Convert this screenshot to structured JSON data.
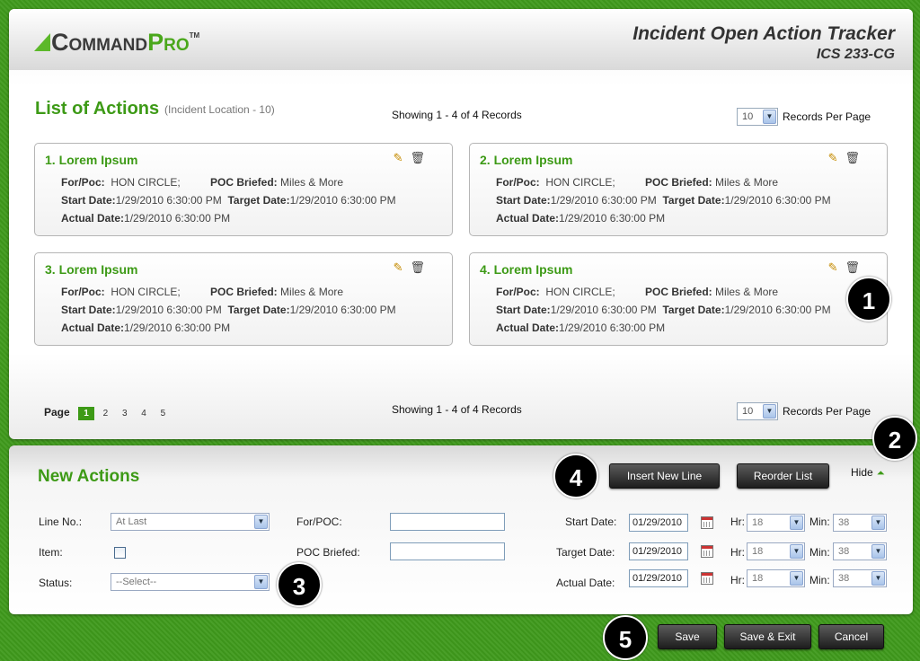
{
  "header": {
    "logo_command": "Command",
    "logo_pro": "Pro",
    "logo_tm": "TM",
    "title": "Incident Open Action Tracker",
    "subtitle": "ICS 233-CG"
  },
  "list": {
    "heading": "List of Actions",
    "subheading": "(Incident Location - 10)",
    "showing": "Showing 1 - 4 of 4 Records",
    "rpp_value": "10",
    "rpp_label": "Records Per Page",
    "page_label": "Page",
    "pages": [
      "1",
      "2",
      "3",
      "4",
      "5"
    ],
    "cards": [
      {
        "title": "1. Lorem Ipsum",
        "for_poc_label": "For/Poc:",
        "for_poc": "HON CIRCLE;",
        "poc_briefed_label": "POC Briefed:",
        "poc_briefed": "Miles & More",
        "start_label": "Start Date:",
        "start": "1/29/2010 6:30:00 PM",
        "target_label": "Target Date:",
        "target": "1/29/2010 6:30:00 PM",
        "actual_label": "Actual Date:",
        "actual": "1/29/2010 6:30:00 PM"
      },
      {
        "title": "2. Lorem Ipsum",
        "for_poc_label": "For/Poc:",
        "for_poc": "HON CIRCLE;",
        "poc_briefed_label": "POC Briefed:",
        "poc_briefed": "Miles & More",
        "start_label": "Start Date:",
        "start": "1/29/2010 6:30:00 PM",
        "target_label": "Target Date:",
        "target": "1/29/2010 6:30:00 PM",
        "actual_label": "Actual Date:",
        "actual": "1/29/2010 6:30:00 PM"
      },
      {
        "title": "3. Lorem Ipsum",
        "for_poc_label": "For/Poc:",
        "for_poc": "HON CIRCLE;",
        "poc_briefed_label": "POC Briefed:",
        "poc_briefed": "Miles & More",
        "start_label": "Start Date:",
        "start": "1/29/2010 6:30:00 PM",
        "target_label": "Target Date:",
        "target": "1/29/2010 6:30:00 PM",
        "actual_label": "Actual Date:",
        "actual": "1/29/2010 6:30:00 PM"
      },
      {
        "title": "4. Lorem Ipsum",
        "for_poc_label": "For/Poc:",
        "for_poc": "HON CIRCLE;",
        "poc_briefed_label": "POC Briefed:",
        "poc_briefed": "Miles & More",
        "start_label": "Start Date:",
        "start": "1/29/2010 6:30:00 PM",
        "target_label": "Target Date:",
        "target": "1/29/2010 6:30:00 PM",
        "actual_label": "Actual Date:",
        "actual": "1/29/2010 6:30:00 PM"
      }
    ]
  },
  "new_actions": {
    "heading": "New Actions",
    "insert_label": "Insert New Line",
    "reorder_label": "Reorder List",
    "hide_label": "Hide",
    "line_no_label": "Line No.:",
    "line_no_value": "At Last",
    "item_label": "Item:",
    "status_label": "Status:",
    "status_value": "--Select--",
    "for_poc_label": "For/POC:",
    "for_poc_value": "",
    "poc_briefed_label": "POC Briefed:",
    "poc_briefed_value": "",
    "dates": [
      {
        "label": "Start Date:",
        "value": "01/29/2010",
        "hr_label": "Hr:",
        "hr": "18",
        "min_label": "Min:",
        "min": "38"
      },
      {
        "label": "Target Date:",
        "value": "01/29/2010",
        "hr_label": "Hr:",
        "hr": "18",
        "min_label": "Min:",
        "min": "38"
      },
      {
        "label": "Actual Date:",
        "value": "01/29/2010",
        "hr_label": "Hr:",
        "hr": "18",
        "min_label": "Min:",
        "min": "38"
      }
    ]
  },
  "footer": {
    "save_label": "Save",
    "save_exit_label": "Save & Exit",
    "cancel_label": "Cancel"
  },
  "callouts": [
    "1",
    "2",
    "3",
    "4",
    "5"
  ],
  "colors": {
    "accent_green": "#3d9a16",
    "background_green": "#3f9a1c",
    "button_dark": "#2a2a2a"
  }
}
